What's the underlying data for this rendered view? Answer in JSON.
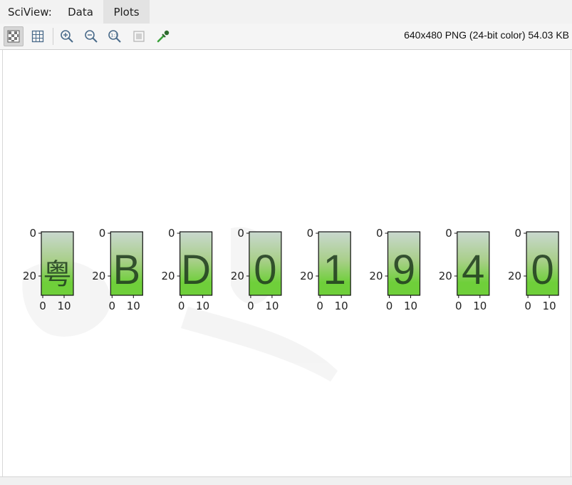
{
  "titlebar": {
    "app_label": "SciView:",
    "tabs": [
      {
        "label": "Data",
        "active": false
      },
      {
        "label": "Plots",
        "active": true
      }
    ]
  },
  "toolbar": {
    "buttons": [
      {
        "name": "checker-background-icon",
        "active": true
      },
      {
        "name": "grid-icon",
        "active": false
      },
      {
        "name": "zoom-in-icon",
        "active": false
      },
      {
        "name": "zoom-out-icon",
        "active": false
      },
      {
        "name": "actual-size-icon",
        "active": false
      },
      {
        "name": "fit-to-window-icon",
        "active": false
      },
      {
        "name": "color-picker-icon",
        "active": false
      }
    ],
    "image_info": "640x480 PNG (24-bit color) 54.03 KB"
  },
  "figure": {
    "panels": [
      {
        "character": "粤"
      },
      {
        "character": "B"
      },
      {
        "character": "D"
      },
      {
        "character": "0"
      },
      {
        "character": "1"
      },
      {
        "character": "9"
      },
      {
        "character": "4"
      },
      {
        "character": "0"
      }
    ],
    "y_tick_labels": [
      "0",
      "20"
    ],
    "x_tick_labels": [
      "0",
      "10"
    ],
    "colors": {
      "sky_top": "#c9d8cf",
      "mid": "#a9cf8a",
      "grass": "#6fcf3a",
      "glyph": "#1f3a1f"
    }
  }
}
